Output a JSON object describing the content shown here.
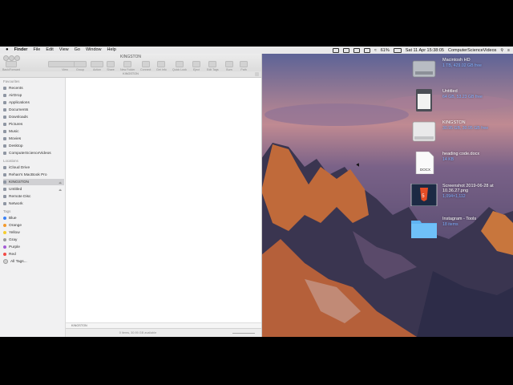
{
  "menubar": {
    "apple": "",
    "items": [
      "Finder",
      "File",
      "Edit",
      "View",
      "Go",
      "Window",
      "Help"
    ],
    "battery": "61%",
    "datetime": "Sat 11 Apr  15:38:05",
    "user": "ComputerScienceVideos"
  },
  "window": {
    "title": "KINGSTON",
    "path_title": "KINGSTON",
    "toolbar": [
      "Back/Forward",
      "View",
      "Group",
      "Action",
      "Share",
      "New Folder",
      "Connect",
      "Get Info",
      "Quick Look",
      "Eject",
      "Edit Tags",
      "Burn",
      "Path"
    ],
    "path_strip": "KINGSTON",
    "status": "0 items, 30.95 GB available"
  },
  "sidebar": {
    "favourites_heading": "Favourites",
    "favourites": [
      "Recents",
      "AirDrop",
      "Applications",
      "Documents",
      "Downloads",
      "Pictures",
      "Music",
      "Movies",
      "Desktop",
      "ComputerScienceVideos"
    ],
    "locations_heading": "Locations",
    "locations": [
      "iCloud Drive",
      "Rehan's MacBook Pro",
      "KINGSTON",
      "Untitled",
      "Remote Disc",
      "Network"
    ],
    "tags_heading": "Tags",
    "tags": [
      {
        "label": "Blue",
        "color": "#3a82f7"
      },
      {
        "label": "Orange",
        "color": "#f39a2b"
      },
      {
        "label": "Yellow",
        "color": "#f5cd2e"
      },
      {
        "label": "Gray",
        "color": "#9a9a9a"
      },
      {
        "label": "Purple",
        "color": "#a55bd6"
      },
      {
        "label": "Red",
        "color": "#f24a45"
      },
      {
        "label": "All Tags...",
        "color": "#d0d0d0"
      }
    ]
  },
  "desktop": [
    {
      "name": "Macintosh HD",
      "info": "1 TB, 429.02 GB free",
      "icon": "hard-drive-icon"
    },
    {
      "name": "Untitled",
      "info": "64 GB, 53.23 GB free",
      "icon": "sd-card-icon"
    },
    {
      "name": "KINGSTON",
      "info": "30.95 GB, 30.95 GB free",
      "icon": "usb-drive-icon"
    },
    {
      "name": "heading code.docx",
      "info": "14 KB",
      "icon": "document-icon"
    },
    {
      "name": "Screenshot 2019-06-28 at 10.36.27.png",
      "info": "1,094×1,112",
      "icon": "image-thumbnail-icon"
    },
    {
      "name": "Instagram - Tools",
      "info": "18 items",
      "icon": "folder-icon"
    }
  ],
  "colors": {
    "selected": "#d0d0d3",
    "label_info": "#7fb0ff",
    "folder": "#5fb3f2"
  }
}
